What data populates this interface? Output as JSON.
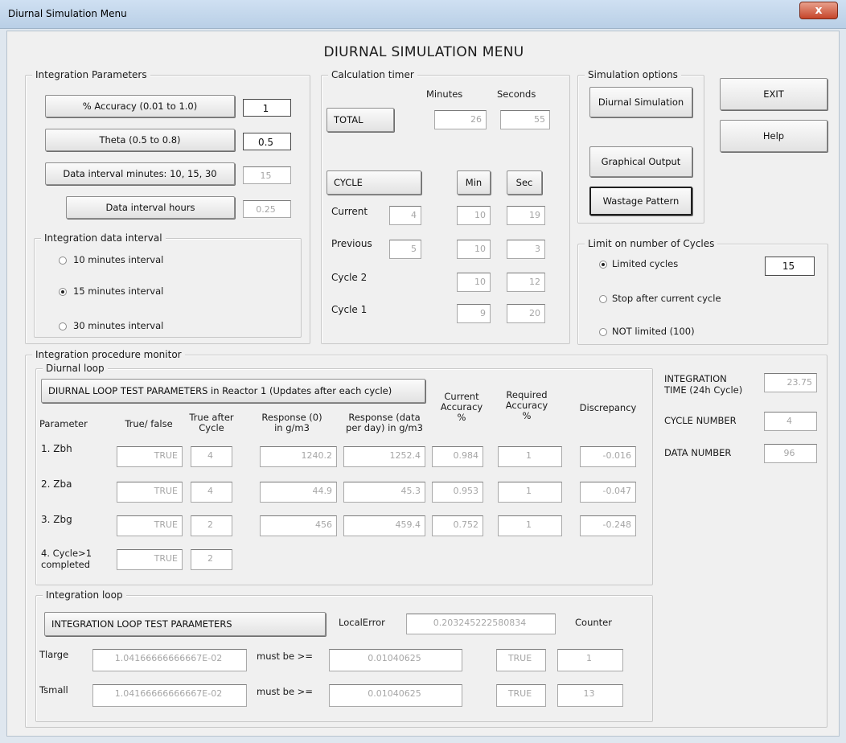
{
  "window": {
    "title": "Diurnal Simulation Menu",
    "close_glyph": "x"
  },
  "main_title": "DIURNAL SIMULATION MENU",
  "integration_parameters": {
    "legend": "Integration Parameters",
    "accuracy_button": "% Accuracy (0.01 to 1.0)",
    "accuracy_value": "1",
    "theta_button": "Theta (0.5 to 0.8)",
    "theta_value": "0.5",
    "data_interval_minutes_button": "Data interval minutes: 10, 15, 30",
    "data_interval_minutes_value": "15",
    "data_interval_hours_button": "Data interval hours",
    "data_interval_hours_value": "0.25"
  },
  "integration_data_interval": {
    "legend": "Integration data interval",
    "options": [
      "10 minutes interval",
      "15 minutes interval",
      "30 minutes interval"
    ],
    "selected": "15 minutes interval"
  },
  "calculation_timer": {
    "legend": "Calculation timer",
    "minutes_header": "Minutes",
    "seconds_header": "Seconds",
    "total_button": "TOTAL",
    "total_minutes": "26",
    "total_seconds": "55",
    "cycle_button": "CYCLE",
    "min_button": "Min",
    "sec_button": "Sec",
    "rows": [
      {
        "label": "Current",
        "cycle": "4",
        "min": "10",
        "sec": "19"
      },
      {
        "label": "Previous",
        "cycle": "5",
        "min": "10",
        "sec": "3"
      },
      {
        "label": "Cycle 2",
        "cycle": "",
        "min": "10",
        "sec": "12"
      },
      {
        "label": "Cycle 1",
        "cycle": "",
        "min": "9",
        "sec": "20"
      }
    ]
  },
  "simulation_options": {
    "legend": "Simulation options",
    "diurnal_button": "Diurnal Simulation",
    "graphical_button": "Graphical Output",
    "wastage_button": "Wastage Pattern"
  },
  "exit_button": "EXIT",
  "help_button": "Help",
  "limit_cycles": {
    "legend": "Limit on number of Cycles",
    "options": [
      "Limited cycles",
      "Stop after current cycle",
      "NOT limited (100)"
    ],
    "selected": "Limited cycles",
    "limited_value": "15"
  },
  "monitor": {
    "legend": "Integration procedure monitor",
    "diurnal_loop": {
      "legend": "Diurnal loop",
      "test_button": "DIURNAL LOOP TEST PARAMETERS in Reactor 1 (Updates after each cycle)",
      "headers": {
        "parameter": "Parameter",
        "true_false": "True/ false",
        "true_after": "True after\nCycle",
        "response0": "Response (0)\nin g/m3",
        "response_data": "Response (data\nper day) in g/m3",
        "current_accuracy": "Current\nAccuracy\n%",
        "required_accuracy": "Required\nAccuracy\n%",
        "discrepancy": "Discrepancy"
      },
      "rows": [
        {
          "param": "1. Zbh",
          "tf": "TRUE",
          "after": "4",
          "r0": "1240.2",
          "rd": "1252.4",
          "cur": "0.984",
          "req": "1",
          "disc": "-0.016"
        },
        {
          "param": "2. Zba",
          "tf": "TRUE",
          "after": "4",
          "r0": "44.9",
          "rd": "45.3",
          "cur": "0.953",
          "req": "1",
          "disc": "-0.047"
        },
        {
          "param": "3. Zbg",
          "tf": "TRUE",
          "after": "2",
          "r0": "456",
          "rd": "459.4",
          "cur": "0.752",
          "req": "1",
          "disc": "-0.248"
        },
        {
          "param": "4. Cycle>1\ncompleted",
          "tf": "TRUE",
          "after": "2"
        }
      ]
    },
    "stats": {
      "integration_time_label": "INTEGRATION\nTIME (24h Cycle)",
      "integration_time": "23.75",
      "cycle_number_label": "CYCLE NUMBER",
      "cycle_number": "4",
      "data_number_label": "DATA NUMBER",
      "data_number": "96"
    },
    "integration_loop": {
      "legend": "Integration loop",
      "test_button": "INTEGRATION LOOP TEST PARAMETERS",
      "local_error_label": "LocalError",
      "local_error": "0.203245222580834",
      "counter_label": "Counter",
      "tlarge_label": "Tlarge",
      "tlarge": "1.04166666666667E-02",
      "tlarge_must": "must be >=",
      "tlarge_target": "0.01040625",
      "tlarge_bool": "TRUE",
      "tlarge_counter": "1",
      "tsmall_label": "Tsmall",
      "tsmall": "1.04166666666667E-02",
      "tsmall_must": "must be >=",
      "tsmall_target": "0.01040625",
      "tsmall_bool": "TRUE",
      "tsmall_counter": "13"
    }
  }
}
